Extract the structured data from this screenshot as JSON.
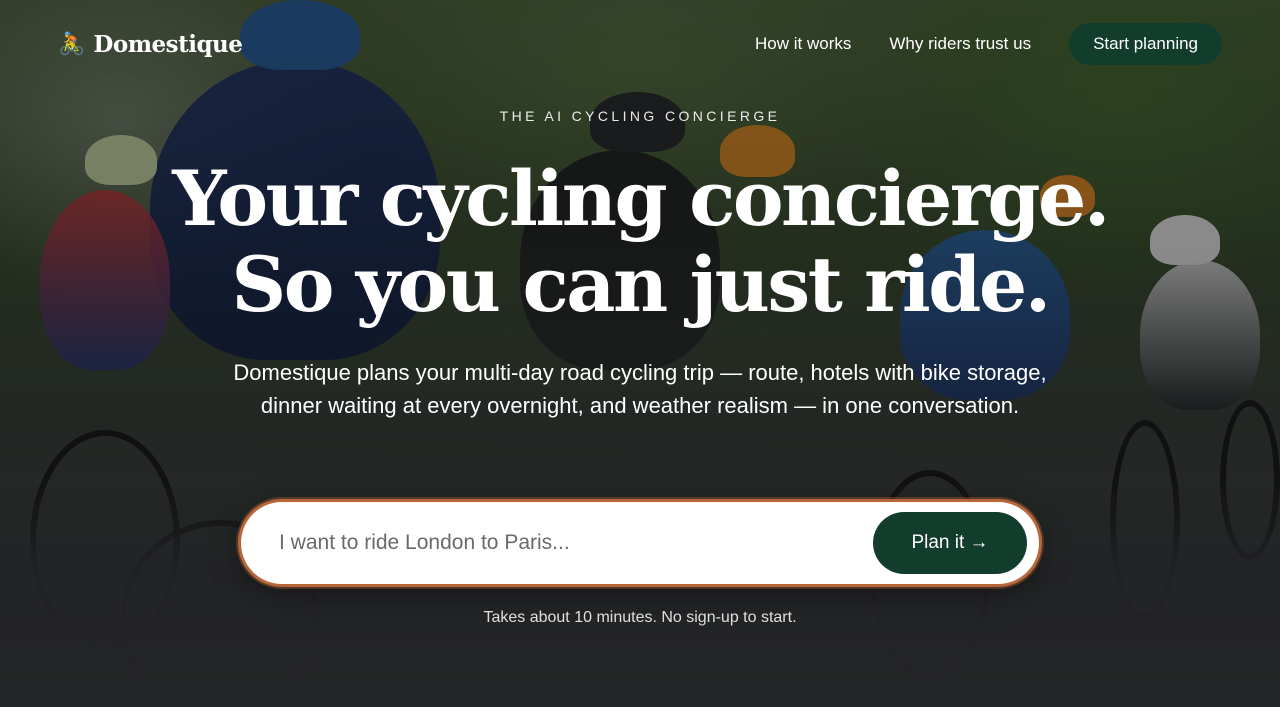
{
  "brand": {
    "name": "Domestique",
    "icon": "cyclist-icon"
  },
  "nav": {
    "links": [
      "How it works",
      "Why riders trust us"
    ],
    "cta_label": "Start planning"
  },
  "hero": {
    "eyebrow": "THE AI CYCLING CONCIERGE",
    "headline_line1": "Your cycling concierge.",
    "headline_line2": "So you can just ride.",
    "subhead": "Domestique plans your multi-day road cycling trip — route, hotels with bike storage, dinner waiting at every overnight, and weather realism — in one conversation.",
    "prompt": {
      "placeholder": "I want to ride London to Paris...",
      "button_label": "Plan it →"
    },
    "note": "Takes about 10 minutes. No sign-up to start."
  },
  "colors": {
    "primary": "#123d2c",
    "prompt_border": "#b8673a"
  },
  "background": {
    "description_icon": "peloton-photo"
  }
}
